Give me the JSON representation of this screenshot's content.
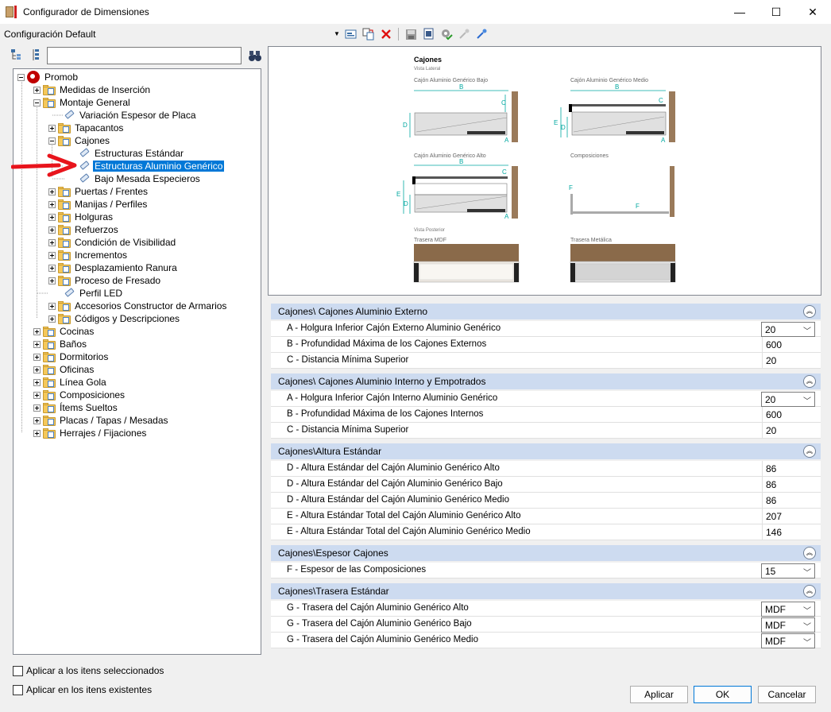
{
  "window": {
    "title": "Configurador de Dimensiones",
    "minimize": "—",
    "maximize": "☐",
    "close": "✕"
  },
  "config": {
    "label": "Configuración Default"
  },
  "tree": {
    "items": [
      {
        "label": "Promob"
      },
      {
        "label": "Medidas de Inserción"
      },
      {
        "label": "Montaje General"
      },
      {
        "label": "Variación Espesor de Placa"
      },
      {
        "label": "Tapacantos"
      },
      {
        "label": "Cajones"
      },
      {
        "label": "Estructuras Estándar"
      },
      {
        "label": "Estructuras Aluminio Genérico"
      },
      {
        "label": "Bajo Mesada Especieros"
      },
      {
        "label": "Puertas / Frentes"
      },
      {
        "label": "Manijas / Perfiles"
      },
      {
        "label": "Holguras"
      },
      {
        "label": "Refuerzos"
      },
      {
        "label": "Condición de Visibilidad"
      },
      {
        "label": "Incrementos"
      },
      {
        "label": "Desplazamiento Ranura"
      },
      {
        "label": "Proceso de Fresado"
      },
      {
        "label": "Perfil LED"
      },
      {
        "label": "Accesorios Constructor de Armarios"
      },
      {
        "label": "Códigos y Descripciones"
      },
      {
        "label": "Cocinas"
      },
      {
        "label": "Baños"
      },
      {
        "label": "Dormitorios"
      },
      {
        "label": "Oficinas"
      },
      {
        "label": "Línea Gola"
      },
      {
        "label": "Composiciones"
      },
      {
        "label": "Ítems Sueltos"
      },
      {
        "label": "Placas / Tapas / Mesadas"
      },
      {
        "label": "Herrajes / Fijaciones"
      }
    ]
  },
  "options": {
    "apply_selected": "Aplicar a los itens seleccionados",
    "apply_existing": "Aplicar en los itens existentes"
  },
  "preview": {
    "title": "Cajones",
    "subtitle": "Vista Lateral",
    "d1": "Cajón Aluminio Genérico Bajo",
    "d2": "Cajón Aluminio Genérico Medio",
    "d3": "Cajón Aluminio Genérico Alto",
    "d4": "Composiciones",
    "rear": "Vista Posterior",
    "r1": "Trasera MDF",
    "r2": "Trasera Metálica",
    "lA": "A",
    "lB": "B",
    "lC": "C",
    "lD": "D",
    "lE": "E",
    "lF": "F"
  },
  "sections": [
    {
      "title": "Cajones\\ Cajones Aluminio Externo",
      "rows": [
        {
          "label": "A - Holgura Inferior Cajón Externo Aluminio Genérico",
          "value": "20"
        },
        {
          "label": "B - Profundidad Máxima de los Cajones Externos",
          "value": "600"
        },
        {
          "label": "C - Distancia Mínima Superior",
          "value": "20"
        }
      ]
    },
    {
      "title": "Cajones\\ Cajones Aluminio Interno y Empotrados",
      "rows": [
        {
          "label": "A - Holgura Inferior Cajón Interno Aluminio Genérico",
          "value": "20"
        },
        {
          "label": "B - Profundidad Máxima de los Cajones Internos",
          "value": "600"
        },
        {
          "label": "C - Distancia Mínima Superior",
          "value": "20"
        }
      ]
    },
    {
      "title": "Cajones\\Altura Estándar",
      "rows": [
        {
          "label": "D - Altura Estándar del Cajón Aluminio Genérico Alto",
          "value": "86"
        },
        {
          "label": "D - Altura Estándar del Cajón Aluminio Genérico Bajo",
          "value": "86"
        },
        {
          "label": "D - Altura Estándar del Cajón Aluminio Genérico Medio",
          "value": "86"
        },
        {
          "label": "E - Altura Estándar Total del Cajón Aluminio Genérico Alto",
          "value": "207"
        },
        {
          "label": "E - Altura Estándar Total del Cajón Aluminio Genérico Medio",
          "value": "146"
        }
      ]
    },
    {
      "title": "Cajones\\Espesor Cajones",
      "rows": [
        {
          "label": "F - Espesor de las Composiciones",
          "value": "15"
        }
      ]
    },
    {
      "title": "Cajones\\Trasera Estándar",
      "rows": [
        {
          "label": "G - Trasera del Cajón Aluminio Genérico Alto",
          "value": "MDF"
        },
        {
          "label": "G - Trasera del Cajón Aluminio Genérico Bajo",
          "value": "MDF"
        },
        {
          "label": "G - Trasera del Cajón Aluminio Genérico Medio",
          "value": "MDF"
        }
      ]
    }
  ],
  "buttons": {
    "apply": "Aplicar",
    "ok": "OK",
    "cancel": "Cancelar"
  }
}
